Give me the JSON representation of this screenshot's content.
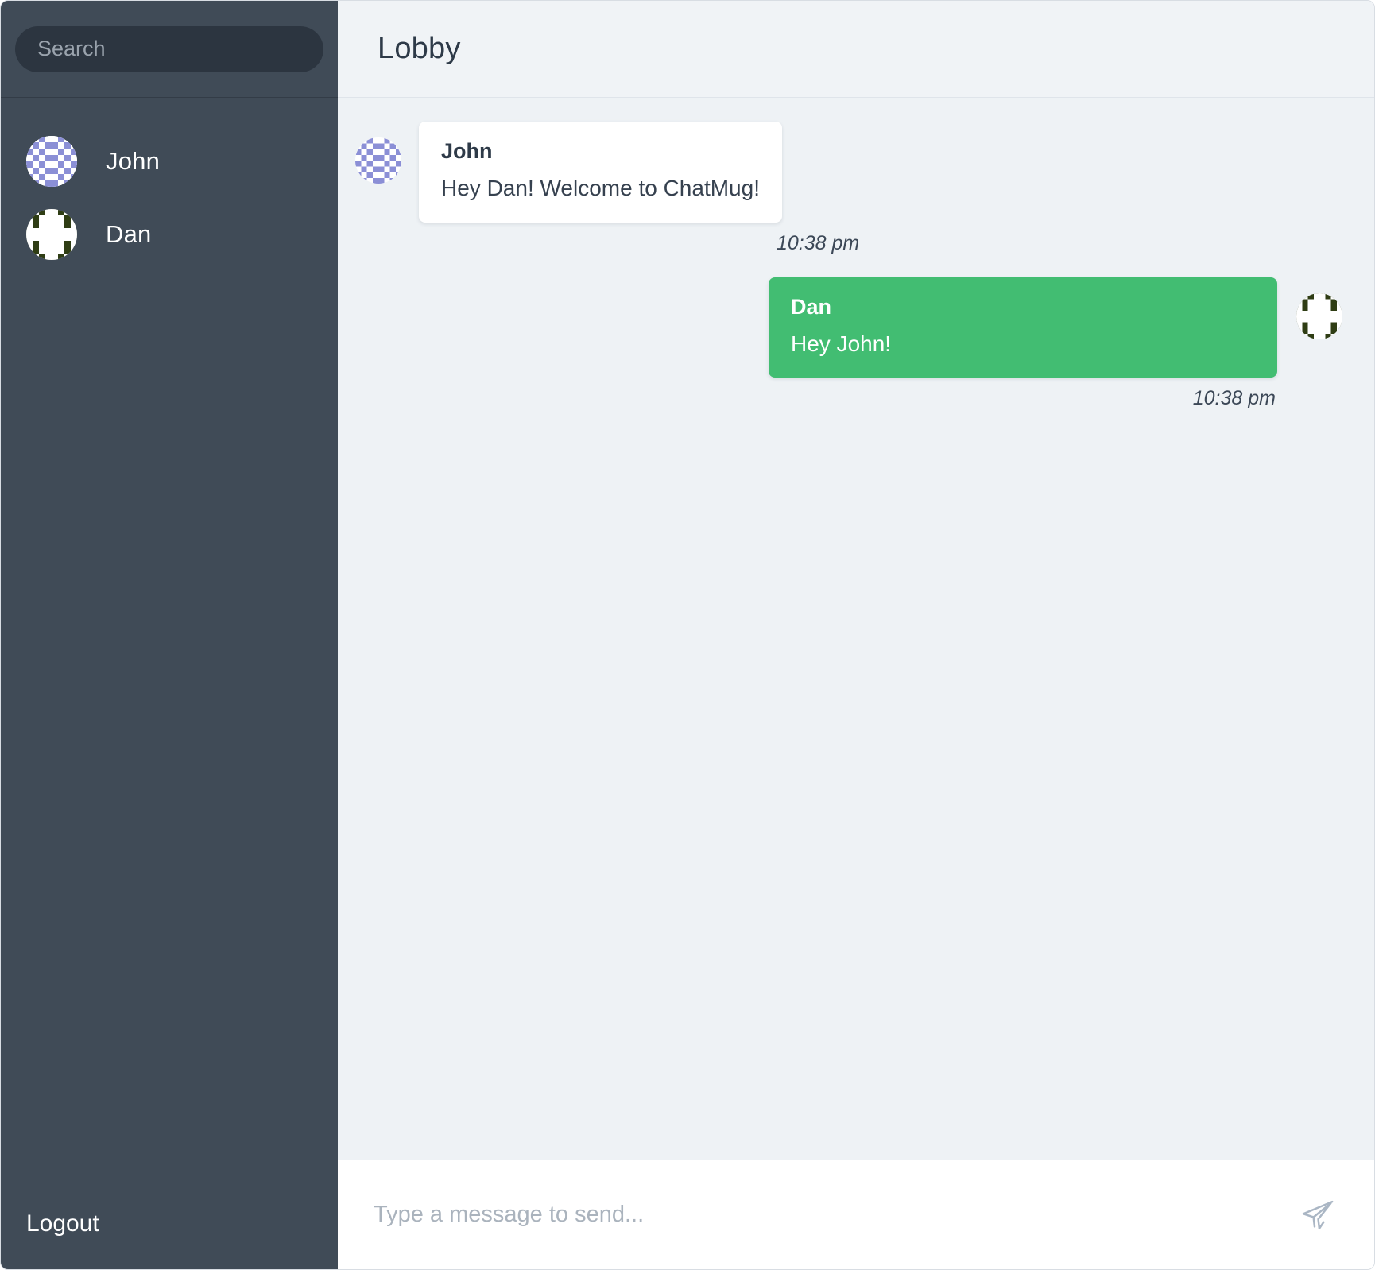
{
  "app": {
    "name": "ChatMug",
    "accent_green": "#42bd72",
    "sidebar_bg": "#404b57",
    "chat_bg": "#eef2f5"
  },
  "sidebar": {
    "search": {
      "placeholder": "Search",
      "value": ""
    },
    "users": [
      {
        "name": "John",
        "avatar": "identicon-purple",
        "avatar_color": "#8b8fd6"
      },
      {
        "name": "Dan",
        "avatar": "identicon-olive",
        "avatar_color": "#2f3d14"
      }
    ],
    "logout_label": "Logout"
  },
  "header": {
    "room_title": "Lobby"
  },
  "messages": [
    {
      "author": "John",
      "text": "Hey Dan! Welcome to ChatMug!",
      "time": "10:38 pm",
      "side": "left",
      "avatar": "identicon-purple"
    },
    {
      "author": "Dan",
      "text": "Hey John!",
      "time": "10:38 pm",
      "side": "right",
      "avatar": "identicon-olive"
    }
  ],
  "composer": {
    "placeholder": "Type a message to send...",
    "value": "",
    "send_icon": "paper-plane-icon"
  }
}
